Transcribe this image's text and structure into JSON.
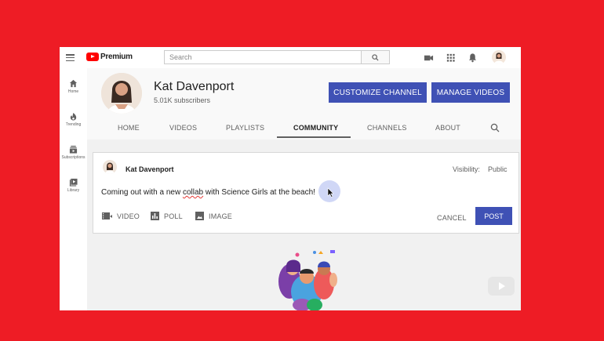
{
  "topbar": {
    "logo_text": "Premium",
    "search_placeholder": "Search"
  },
  "sidebar": {
    "items": [
      {
        "label": "Home",
        "icon": "home-icon"
      },
      {
        "label": "Trending",
        "icon": "flame-icon"
      },
      {
        "label": "Subscriptions",
        "icon": "subscriptions-icon"
      },
      {
        "label": "Library",
        "icon": "library-icon"
      }
    ]
  },
  "channel": {
    "name": "Kat Davenport",
    "subscribers": "5.01K subscribers",
    "customize_label": "CUSTOMIZE CHANNEL",
    "manage_label": "MANAGE VIDEOS"
  },
  "tabs": [
    "HOME",
    "VIDEOS",
    "PLAYLISTS",
    "COMMUNITY",
    "CHANNELS",
    "ABOUT"
  ],
  "active_tab": "COMMUNITY",
  "post": {
    "author": "Kat Davenport",
    "visibility_label": "Visibility:",
    "visibility_value": "Public",
    "text_before": "Coming out with a new ",
    "text_misspelled": "collab",
    "text_after": " with Science Girls at the beach!",
    "actions": {
      "video": "VIDEO",
      "poll": "POLL",
      "image": "IMAGE"
    },
    "cancel_label": "CANCEL",
    "post_label": "POST"
  },
  "colors": {
    "background": "#ee1c25",
    "accent": "#3f51b5",
    "brand_red": "#ff0000"
  }
}
